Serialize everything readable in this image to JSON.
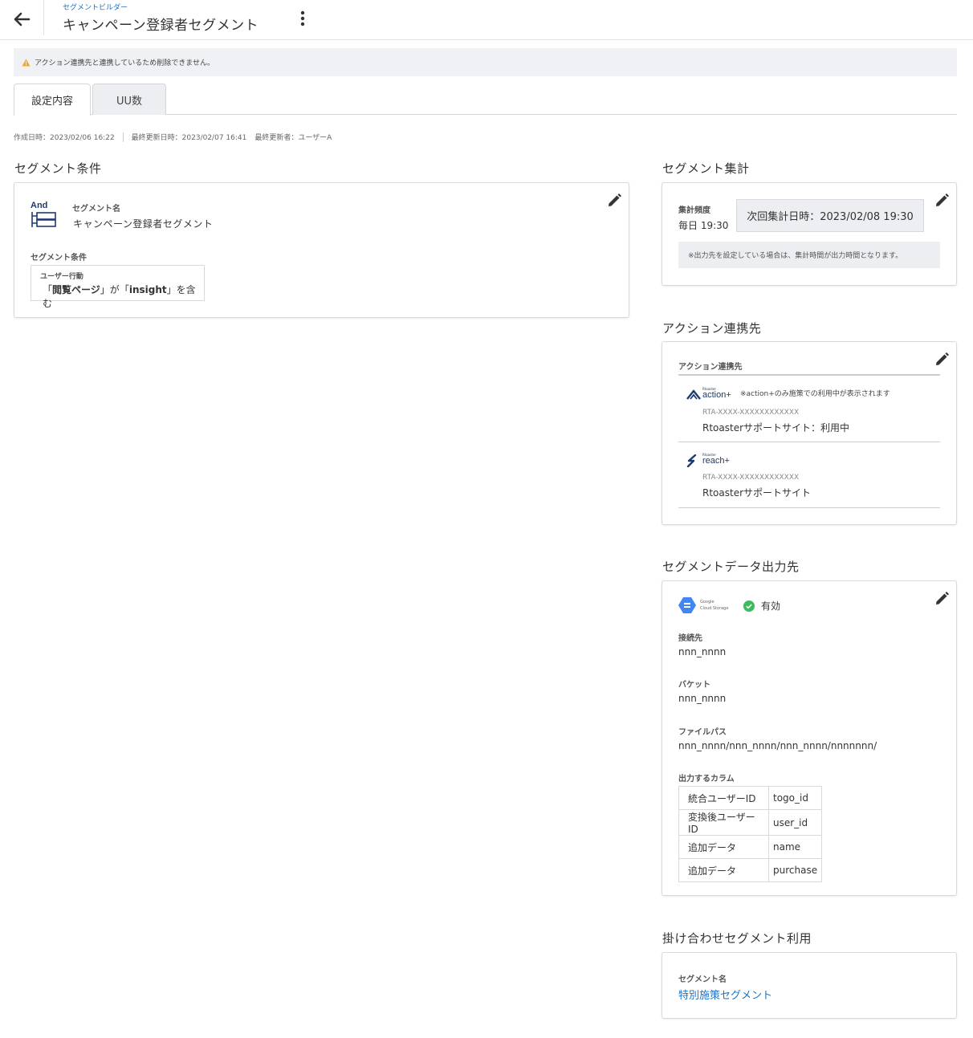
{
  "header": {
    "breadcrumb": "セグメントビルダー",
    "title": "キャンペーン登録者セグメント"
  },
  "alert": {
    "message": "アクション連携先と連携しているため削除できません。",
    "icon": "warning-icon",
    "icon_color": "#f5a623"
  },
  "tabs": [
    {
      "label": "設定内容",
      "active": true
    },
    {
      "label": "UU数",
      "active": false
    }
  ],
  "meta": {
    "created": "作成日時：2023/02/06 16:22",
    "updated": "最終更新日時：2023/02/07 16:41",
    "updated_by": "最終更新者：ユーザーA"
  },
  "segment_conditions": {
    "section_title": "セグメント条件",
    "logic_icon_label": "And",
    "name_label": "セグメント名",
    "name_value": "キャンペーン登録者セグメント",
    "conditions_label": "セグメント条件",
    "condition": {
      "type_label": "ユーザー行動",
      "open1": "「",
      "page": "閲覧ページ",
      "close1": "」",
      "ga": "が",
      "open2": "「",
      "keyword": "insight",
      "close2": "」",
      "suffix": "を含む"
    }
  },
  "aggregation": {
    "section_title": "セグメント集計",
    "freq_label": "集計頻度",
    "freq_value": "毎日 19:30",
    "next_run": "次回集計日時：2023/02/08 19:30",
    "note": "※出力先を設定している場合は、集計時間が出力時間となります。"
  },
  "actions": {
    "section_title": "アクション連携先",
    "head_label": "アクション連携先",
    "items": [
      {
        "logo_small": "Rtoaster",
        "logo_name": "action+",
        "note": "※action+のみ施策での利用中が表示されます",
        "rta": "RTA-XXXX-XXXXXXXXXXXX",
        "site": "Rtoasterサポートサイト：利用中"
      },
      {
        "logo_small": "Rtoaster",
        "logo_name": "reach+",
        "rta": "RTA-XXXX-XXXXXXXXXXXX",
        "site": "Rtoasterサポートサイト"
      }
    ]
  },
  "output": {
    "section_title": "セグメントデータ出力先",
    "gcs_line1": "Google",
    "gcs_line2": "Cloud Storage",
    "status": "有効",
    "status_color": "#3dba5e",
    "connection_label": "接続先",
    "connection_value": "nnn_nnnn",
    "bucket_label": "バケット",
    "bucket_value": "nnn_nnnn",
    "path_label": "ファイルパス",
    "path_value": "nnn_nnnn/nnn_nnnn/nnn_nnnn/nnnnnnn/",
    "columns_label": "出力するカラム",
    "columns": [
      {
        "name": "統合ユーザーID",
        "value": "togo_id"
      },
      {
        "name": "変換後ユーザーID",
        "value": "user_id"
      },
      {
        "name": "追加データ",
        "value": "name"
      },
      {
        "name": "追加データ",
        "value": "purchase"
      }
    ]
  },
  "combined": {
    "section_title": "掛け合わせセグメント利用",
    "name_label": "セグメント名",
    "link": "特別施策セグメント"
  }
}
